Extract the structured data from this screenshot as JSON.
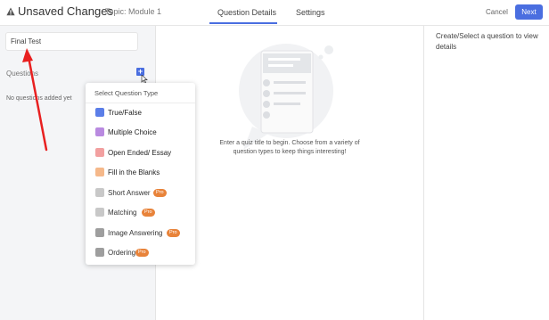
{
  "header": {
    "title": "Unsaved Changes",
    "topic": "Topic: Module 1",
    "tabs": [
      "Question Details",
      "Settings"
    ],
    "cancel_label": "Cancel",
    "next_label": "Next",
    "accent_color": "#4a6ee0"
  },
  "left": {
    "quiz_title_value": "Final Test",
    "questions_label": "Questions",
    "add_button_label": "+",
    "no_questions_text": "No questions added yet"
  },
  "center": {
    "empty_hint": "Enter a quiz title to begin. Choose from a variety of question types to keep things interesting!"
  },
  "right": {
    "hint": "Create/Select a question to view details"
  },
  "question_type_menu": {
    "header": "Select Question Type",
    "items": [
      {
        "label": "True/False",
        "icon": "true-false-icon",
        "icon_color": "#5b7ee8",
        "pro": ""
      },
      {
        "label": "Multiple Choice",
        "icon": "multiple-choice-icon",
        "icon_color": "#b98ae0",
        "pro": ""
      },
      {
        "label": "Open Ended/ Essay",
        "icon": "open-ended-icon",
        "icon_color": "#f2a0a0",
        "pro": ""
      },
      {
        "label": "Fill in the Blanks",
        "icon": "fill-blanks-icon",
        "icon_color": "#f5b88a",
        "pro": ""
      },
      {
        "label": "Short Answer",
        "icon": "short-answer-icon",
        "icon_color": "#bdbdbd",
        "pro": "Pro"
      },
      {
        "label": "Matching",
        "icon": "matching-icon",
        "icon_color": "#bdbdbd",
        "pro": "Pro"
      },
      {
        "label": "Image Answering",
        "icon": "image-answering-icon",
        "icon_color": "#9e9e9e",
        "pro": "Pro"
      },
      {
        "label": "Ordering",
        "icon": "ordering-icon",
        "icon_color": "#9e9e9e",
        "pro": "Pro"
      }
    ],
    "pro_color": "#e8833a"
  },
  "annotation": {
    "arrow_color": "#e82020"
  }
}
